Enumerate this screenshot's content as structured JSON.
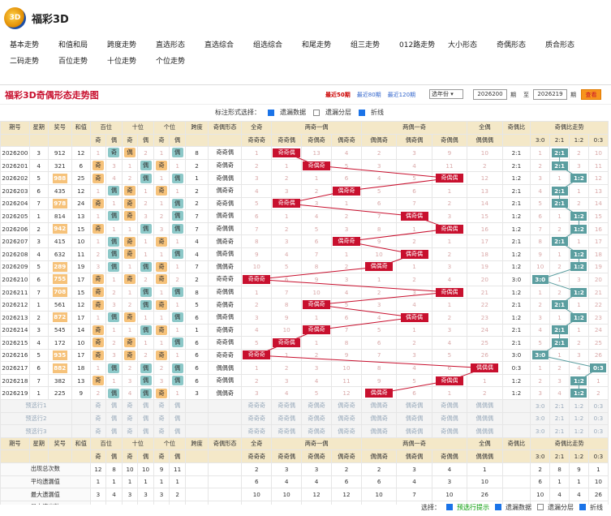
{
  "app": {
    "title": "福彩3D",
    "logo_text": "3D"
  },
  "nav": [
    "基本走势",
    "和值和局",
    "跨度走势",
    "直选形态",
    "直选综合",
    "组选综合",
    "和尾走势",
    "组三走势",
    "012路走势",
    "大小形态",
    "奇偶形态",
    "质合形态",
    "二码走势",
    "百位走势",
    "十位走势",
    "个位走势"
  ],
  "panel": {
    "title": "福彩3D奇偶形态走势图",
    "links": [
      "最近50期",
      "最近80期",
      "最近120期"
    ],
    "year_select": "选年份",
    "from": "2026200",
    "to": "2026219",
    "period_label": "期",
    "to_label": "至",
    "query": "查看"
  },
  "options": {
    "label": "标注形式选择：",
    "items": [
      {
        "label": "遗漏数据",
        "checked": true
      },
      {
        "label": "遗漏分层",
        "checked": false
      },
      {
        "label": "折线",
        "checked": true
      }
    ]
  },
  "headers": {
    "top": [
      "期号",
      "星期",
      "奖号",
      "和值",
      "百位",
      "十位",
      "个位",
      "跨度",
      "奇偶形态",
      "全奇",
      "两奇一偶",
      "两偶一奇",
      "全偶",
      "奇偶比",
      "奇偶比走势"
    ],
    "sub": [
      "奇",
      "偶",
      "奇",
      "偶",
      "奇",
      "偶",
      "奇奇奇",
      "奇奇偶",
      "奇偶奇",
      "偶奇奇",
      "偶偶奇",
      "偶奇偶",
      "奇偶偶",
      "偶偶偶",
      "3:0",
      "2:1",
      "1:2",
      "0:3"
    ]
  },
  "rows": [
    {
      "p": "2026200",
      "w": "3",
      "n": "912",
      "s": "12",
      "b": [
        "1",
        "奇"
      ],
      "t": [
        "偶",
        "2"
      ],
      "g": [
        "1",
        "偶"
      ],
      "k": "8",
      "f": "奇奇偶",
      "m": [
        "1",
        "奇奇偶",
        "13",
        "4",
        "2",
        "3",
        "9",
        "10"
      ],
      "r": "2:1",
      "rt": [
        "1",
        "2:1",
        "2",
        "10"
      ]
    },
    {
      "p": "2026201",
      "w": "4",
      "n": "321",
      "s": "6",
      "b": [
        "奇",
        "3"
      ],
      "t": [
        "1",
        "偶"
      ],
      "g": [
        "奇",
        "1"
      ],
      "k": "2",
      "f": "奇偶奇",
      "m": [
        "2",
        "1",
        "奇偶奇",
        "5",
        "3",
        "4",
        "11",
        "2"
      ],
      "r": "2:1",
      "rt": [
        "2",
        "2:1",
        "3",
        "11"
      ]
    },
    {
      "p": "2026202",
      "w": "5",
      "n": "988",
      "s": "25",
      "b": [
        "奇",
        "4"
      ],
      "t": [
        "2",
        "偶"
      ],
      "g": [
        "1",
        "偶"
      ],
      "k": "1",
      "f": "奇偶偶",
      "m": [
        "3",
        "2",
        "1",
        "6",
        "4",
        "5",
        "奇偶偶",
        "12"
      ],
      "r": "1:2",
      "rt": [
        "3",
        "1",
        "1:2",
        "12"
      ]
    },
    {
      "p": "2026203",
      "w": "6",
      "n": "435",
      "s": "12",
      "b": [
        "1",
        "偶"
      ],
      "t": [
        "奇",
        "1"
      ],
      "g": [
        "奇",
        "1"
      ],
      "k": "2",
      "f": "偶奇奇",
      "m": [
        "4",
        "3",
        "2",
        "偶奇奇",
        "5",
        "6",
        "1",
        "13"
      ],
      "r": "2:1",
      "rt": [
        "4",
        "2:1",
        "1",
        "13"
      ]
    },
    {
      "p": "2026204",
      "w": "7",
      "n": "978",
      "s": "24",
      "b": [
        "奇",
        "1"
      ],
      "t": [
        "奇",
        "2"
      ],
      "g": [
        "1",
        "偶"
      ],
      "k": "2",
      "f": "奇奇偶",
      "m": [
        "5",
        "奇奇偶",
        "3",
        "1",
        "6",
        "7",
        "2",
        "14"
      ],
      "r": "2:1",
      "rt": [
        "5",
        "2:1",
        "2",
        "14"
      ]
    },
    {
      "p": "2026205",
      "w": "1",
      "n": "814",
      "s": "13",
      "b": [
        "1",
        "偶"
      ],
      "t": [
        "奇",
        "3"
      ],
      "g": [
        "2",
        "偶"
      ],
      "k": "7",
      "f": "偶奇偶",
      "m": [
        "6",
        "1",
        "4",
        "2",
        "7",
        "偶奇偶",
        "3",
        "15"
      ],
      "r": "1:2",
      "rt": [
        "6",
        "1",
        "1:2",
        "15"
      ]
    },
    {
      "p": "2026206",
      "w": "2",
      "n": "942",
      "s": "15",
      "b": [
        "奇",
        "1"
      ],
      "t": [
        "1",
        "偶"
      ],
      "g": [
        "3",
        "偶"
      ],
      "k": "7",
      "f": "奇偶偶",
      "m": [
        "7",
        "2",
        "5",
        "3",
        "8",
        "1",
        "奇偶偶",
        "16"
      ],
      "r": "1:2",
      "rt": [
        "7",
        "2",
        "1:2",
        "16"
      ]
    },
    {
      "p": "2026207",
      "w": "3",
      "n": "415",
      "s": "10",
      "b": [
        "1",
        "偶"
      ],
      "t": [
        "奇",
        "1"
      ],
      "g": [
        "奇",
        "1"
      ],
      "k": "4",
      "f": "偶奇奇",
      "m": [
        "8",
        "3",
        "6",
        "偶奇奇",
        "9",
        "2",
        "1",
        "17"
      ],
      "r": "2:1",
      "rt": [
        "8",
        "2:1",
        "1",
        "17"
      ]
    },
    {
      "p": "2026208",
      "w": "4",
      "n": "632",
      "s": "11",
      "b": [
        "2",
        "偶"
      ],
      "t": [
        "奇",
        "1"
      ],
      "g": [
        "1",
        "偶"
      ],
      "k": "4",
      "f": "偶奇偶",
      "m": [
        "9",
        "4",
        "7",
        "1",
        "10",
        "偶奇偶",
        "2",
        "18"
      ],
      "r": "1:2",
      "rt": [
        "9",
        "1",
        "1:2",
        "18"
      ]
    },
    {
      "p": "2026209",
      "w": "5",
      "n": "289",
      "s": "19",
      "b": [
        "3",
        "偶"
      ],
      "t": [
        "1",
        "偶"
      ],
      "g": [
        "奇",
        "1"
      ],
      "k": "7",
      "f": "偶偶奇",
      "m": [
        "10",
        "5",
        "8",
        "2",
        "偶偶奇",
        "1",
        "3",
        "19"
      ],
      "r": "1:2",
      "rt": [
        "10",
        "2",
        "1:2",
        "19"
      ]
    },
    {
      "p": "2026210",
      "w": "6",
      "n": "755",
      "s": "17",
      "b": [
        "奇",
        "1"
      ],
      "t": [
        "奇",
        "2"
      ],
      "g": [
        "奇",
        "2"
      ],
      "k": "2",
      "f": "奇奇奇",
      "m": [
        "奇奇奇",
        "6",
        "9",
        "3",
        "1",
        "2",
        "4",
        "20"
      ],
      "r": "3:0",
      "rt": [
        "3:0",
        "1",
        "3",
        "20"
      ]
    },
    {
      "p": "2026211",
      "w": "7",
      "n": "708",
      "s": "15",
      "b": [
        "奇",
        "2"
      ],
      "t": [
        "1",
        "偶"
      ],
      "g": [
        "1",
        "偶"
      ],
      "k": "8",
      "f": "奇偶偶",
      "m": [
        "1",
        "7",
        "10",
        "4",
        "2",
        "3",
        "奇偶偶",
        "21"
      ],
      "r": "1:2",
      "rt": [
        "1",
        "2",
        "1:2",
        "21"
      ]
    },
    {
      "p": "2026212",
      "w": "1",
      "n": "561",
      "s": "12",
      "b": [
        "奇",
        "3"
      ],
      "t": [
        "2",
        "偶"
      ],
      "g": [
        "奇",
        "1"
      ],
      "k": "5",
      "f": "奇偶奇",
      "m": [
        "2",
        "8",
        "奇偶奇",
        "5",
        "3",
        "4",
        "1",
        "22"
      ],
      "r": "2:1",
      "rt": [
        "2",
        "2:1",
        "1",
        "22"
      ]
    },
    {
      "p": "2026213",
      "w": "2",
      "n": "872",
      "s": "17",
      "b": [
        "1",
        "偶"
      ],
      "t": [
        "奇",
        "1"
      ],
      "g": [
        "1",
        "偶"
      ],
      "k": "6",
      "f": "偶奇偶",
      "m": [
        "3",
        "9",
        "1",
        "6",
        "4",
        "偶奇偶",
        "2",
        "23"
      ],
      "r": "1:2",
      "rt": [
        "3",
        "1",
        "1:2",
        "23"
      ]
    },
    {
      "p": "2026214",
      "w": "3",
      "n": "545",
      "s": "14",
      "b": [
        "奇",
        "1"
      ],
      "t": [
        "1",
        "偶"
      ],
      "g": [
        "奇",
        "1"
      ],
      "k": "1",
      "f": "奇偶奇",
      "m": [
        "4",
        "10",
        "奇偶奇",
        "7",
        "5",
        "1",
        "3",
        "24"
      ],
      "r": "2:1",
      "rt": [
        "4",
        "2:1",
        "1",
        "24"
      ]
    },
    {
      "p": "2026215",
      "w": "4",
      "n": "172",
      "s": "10",
      "b": [
        "奇",
        "2"
      ],
      "t": [
        "奇",
        "1"
      ],
      "g": [
        "1",
        "偶"
      ],
      "k": "6",
      "f": "奇奇偶",
      "m": [
        "5",
        "奇奇偶",
        "1",
        "8",
        "6",
        "2",
        "4",
        "25"
      ],
      "r": "2:1",
      "rt": [
        "5",
        "2:1",
        "2",
        "25"
      ]
    },
    {
      "p": "2026216",
      "w": "5",
      "n": "935",
      "s": "17",
      "b": [
        "奇",
        "3"
      ],
      "t": [
        "奇",
        "2"
      ],
      "g": [
        "奇",
        "1"
      ],
      "k": "6",
      "f": "奇奇奇",
      "m": [
        "奇奇奇",
        "1",
        "2",
        "9",
        "7",
        "3",
        "5",
        "26"
      ],
      "r": "3:0",
      "rt": [
        "3:0",
        "1",
        "3",
        "26"
      ]
    },
    {
      "p": "2026217",
      "w": "6",
      "n": "882",
      "s": "18",
      "b": [
        "1",
        "偶"
      ],
      "t": [
        "2",
        "偶"
      ],
      "g": [
        "2",
        "偶"
      ],
      "k": "6",
      "f": "偶偶偶",
      "m": [
        "1",
        "2",
        "3",
        "10",
        "8",
        "4",
        "6",
        "偶偶偶"
      ],
      "r": "0:3",
      "rt": [
        "1",
        "2",
        "4",
        "0:3"
      ]
    },
    {
      "p": "2026218",
      "w": "7",
      "n": "382",
      "s": "13",
      "b": [
        "奇",
        "1"
      ],
      "t": [
        "3",
        "偶"
      ],
      "g": [
        "3",
        "偶"
      ],
      "k": "6",
      "f": "奇偶偶",
      "m": [
        "2",
        "3",
        "4",
        "11",
        "9",
        "5",
        "奇偶偶",
        "1"
      ],
      "r": "1:2",
      "rt": [
        "2",
        "3",
        "1:2",
        "1"
      ]
    },
    {
      "p": "2026219",
      "w": "1",
      "n": "225",
      "s": "9",
      "b": [
        "2",
        "偶"
      ],
      "t": [
        "4",
        "偶"
      ],
      "g": [
        "奇",
        "1"
      ],
      "k": "3",
      "f": "偶偶奇",
      "m": [
        "3",
        "4",
        "5",
        "12",
        "偶偶奇",
        "6",
        "1",
        "2"
      ],
      "r": "1:2",
      "rt": [
        "3",
        "4",
        "1:2",
        "2"
      ]
    }
  ],
  "pre_rows": [
    "预选行1",
    "预选行2",
    "预选行3"
  ],
  "pre_cells": {
    "digits": [
      "奇",
      "偶",
      "奇",
      "偶",
      "奇",
      "偶"
    ],
    "pats": [
      "奇奇奇",
      "奇奇偶",
      "奇偶奇",
      "偶奇奇",
      "偶偶奇",
      "偶奇偶",
      "奇偶偶",
      "偶偶偶"
    ],
    "ratios": [
      "3:0",
      "2:1",
      "1:2",
      "0:3"
    ]
  },
  "stats": [
    {
      "label": "出现总次数",
      "v": [
        "12",
        "8",
        "10",
        "10",
        "9",
        "11"
      ],
      "m": [
        "2",
        "3",
        "3",
        "2",
        "2",
        "3",
        "4",
        "1"
      ],
      "rt": [
        "2",
        "8",
        "9",
        "1"
      ]
    },
    {
      "label": "平均遗漏值",
      "v": [
        "1",
        "1",
        "1",
        "1",
        "1",
        "1"
      ],
      "m": [
        "6",
        "4",
        "4",
        "6",
        "6",
        "4",
        "3",
        "10"
      ],
      "rt": [
        "6",
        "1",
        "1",
        "10"
      ]
    },
    {
      "label": "最大遗漏值",
      "v": [
        "3",
        "4",
        "3",
        "3",
        "3",
        "2"
      ],
      "m": [
        "10",
        "10",
        "12",
        "12",
        "10",
        "7",
        "10",
        "26"
      ],
      "rt": [
        "10",
        "4",
        "4",
        "26"
      ]
    },
    {
      "label": "最大连出数",
      "v": [
        "3",
        "3",
        "3",
        "3",
        "2",
        "3"
      ],
      "m": [
        "0",
        "0",
        "0",
        "0",
        "0",
        "0",
        "0",
        "0"
      ],
      "rt": [
        "0",
        "2",
        "2",
        "0"
      ]
    }
  ],
  "footer": {
    "label": "选择：",
    "items": [
      {
        "label": "预选行提示",
        "checked": true,
        "green": true
      },
      {
        "label": "遗漏数据",
        "checked": true
      },
      {
        "label": "遗漏分层",
        "checked": false
      },
      {
        "label": "折线",
        "checked": true
      }
    ]
  }
}
